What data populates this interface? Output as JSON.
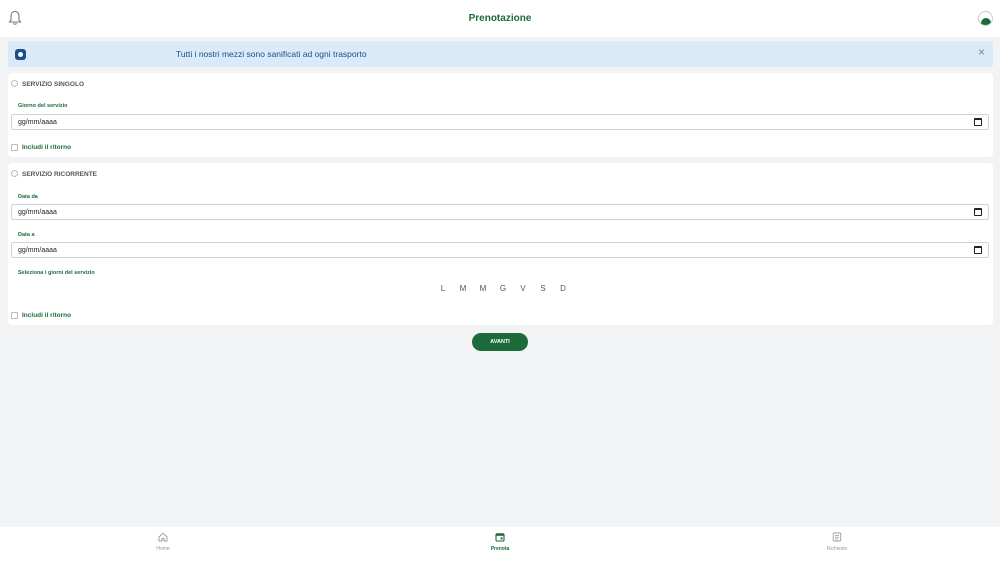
{
  "header": {
    "title": "Prenotazione"
  },
  "banner": {
    "message": "Tutti i nostri mezzi sono sanificati ad ogni trasporto",
    "close_glyph": "×"
  },
  "single_service": {
    "title": "SERVIZIO SINGOLO",
    "date_label": "Giorno del servizio",
    "date_value": "gg/mm/aaaa",
    "return_label": "Includi il ritorno"
  },
  "recurring_service": {
    "title": "SERVIZIO RICORRENTE",
    "from_label": "Data da",
    "from_value": "gg/mm/aaaa",
    "to_label": "Data a",
    "to_value": "gg/mm/aaaa",
    "days_label": "Seleziona i giorni del servizio",
    "days": [
      "L",
      "M",
      "M",
      "G",
      "V",
      "S",
      "D"
    ],
    "return_label": "Includi il ritorno"
  },
  "next_button": "AVANTI",
  "nav": {
    "items": [
      {
        "label": "Home",
        "icon": "home-icon",
        "active": false
      },
      {
        "label": "Prenota",
        "icon": "calendar-icon",
        "active": true
      },
      {
        "label": "Richieste",
        "icon": "list-icon",
        "active": false
      }
    ]
  },
  "colors": {
    "primary_green": "#1d6b3a",
    "banner_bg": "#dbeaf8",
    "banner_text": "#1d4f86",
    "page_bg": "#f2f3f5"
  }
}
